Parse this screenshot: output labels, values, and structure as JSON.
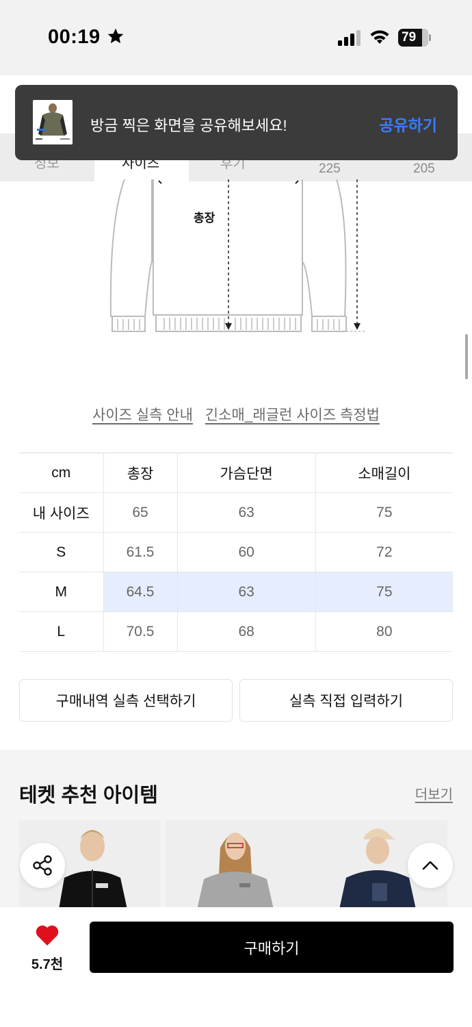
{
  "status_bar": {
    "time": "00:19",
    "battery": "79",
    "icons": [
      "star-icon",
      "signal-icon",
      "wifi-icon",
      "battery-icon"
    ]
  },
  "tabs": {
    "items": [
      {
        "label": "정보"
      },
      {
        "label": "사이즈",
        "active": true
      },
      {
        "label": "후기"
      }
    ],
    "numbers": [
      "225",
      "205"
    ]
  },
  "toast": {
    "message": "방금 찍은 화면을 공유해보세요!",
    "action": "공유하기"
  },
  "diagram": {
    "label": "총장"
  },
  "guide_links": {
    "size_guide": "사이즈 실측 안내",
    "measure_guide": "긴소매_래글런 사이즈 측정법"
  },
  "size_table": {
    "headers": [
      "cm",
      "총장",
      "가슴단면",
      "소매길이"
    ],
    "rows": [
      {
        "label": "내 사이즈",
        "values": [
          "65",
          "63",
          "75"
        ]
      },
      {
        "label": "S",
        "values": [
          "61.5",
          "60",
          "72"
        ]
      },
      {
        "label": "M",
        "values": [
          "64.5",
          "63",
          "75"
        ],
        "highlight": true
      },
      {
        "label": "L",
        "values": [
          "70.5",
          "68",
          "80"
        ]
      }
    ],
    "highlight_color": "#e6edfd"
  },
  "buttons": {
    "select_purchase": "구매내역 실측 선택하기",
    "manual_input": "실측 직접 입력하기"
  },
  "recommend": {
    "title": "테켓 추천 아이템",
    "more": "더보기"
  },
  "bottom": {
    "like_count": "5.7천",
    "buy": "구매하기",
    "accent_color": "#e0101c"
  }
}
